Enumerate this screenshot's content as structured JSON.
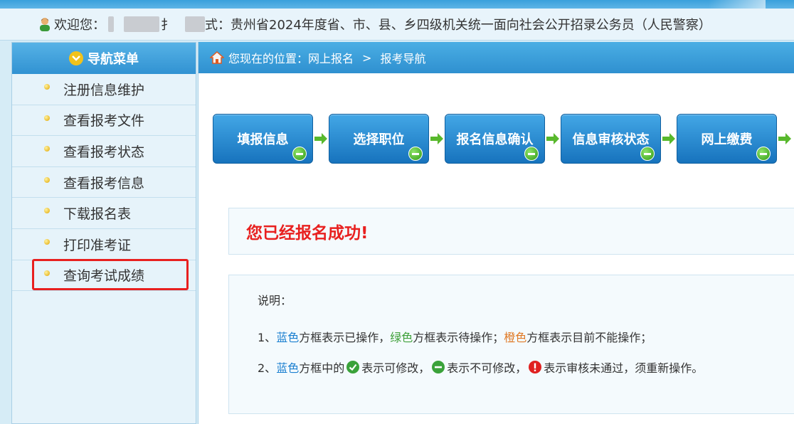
{
  "header": {
    "welcome_label": "欢迎您：",
    "name_fragment": "扌",
    "exam_suffix": "式：贵州省2024年度省、市、县、乡四级机关统一面向社会公开招录公务员（人民警察）"
  },
  "sidebar": {
    "title": "导航菜单",
    "items": [
      {
        "label": "注册信息维护"
      },
      {
        "label": "查看报考文件"
      },
      {
        "label": "查看报考状态"
      },
      {
        "label": "查看报考信息"
      },
      {
        "label": "下载报名表"
      },
      {
        "label": "打印准考证"
      },
      {
        "label": "查询考试成绩"
      }
    ]
  },
  "breadcrumb": {
    "prefix": "您现在的位置：",
    "level1": "网上报名",
    "separator": ">",
    "level2": "报考导航"
  },
  "steps": [
    {
      "label": "填报信息"
    },
    {
      "label": "选择职位"
    },
    {
      "label": "报名信息确认"
    },
    {
      "label": "信息审核状态"
    },
    {
      "label": "网上缴费"
    }
  ],
  "success_message": "您已经报名成功!",
  "description": {
    "title": "说明：",
    "line1": {
      "num": "1、",
      "blue": "蓝色",
      "t1": "方框表示已操作，",
      "green": "绿色",
      "t2": "方框表示待操作；",
      "orange": "橙色",
      "t3": "方框表示目前不能操作；"
    },
    "line2": {
      "num": "2、",
      "blue": "蓝色",
      "t1": "方框中的",
      "t2": "表示可修改，",
      "t3": "表示不可修改，",
      "t4": "表示审核未通过，须重新操作。"
    }
  },
  "colors": {
    "accent_blue": "#2f90d0",
    "highlight_red": "#e8201f",
    "success_red": "#e8201f"
  }
}
